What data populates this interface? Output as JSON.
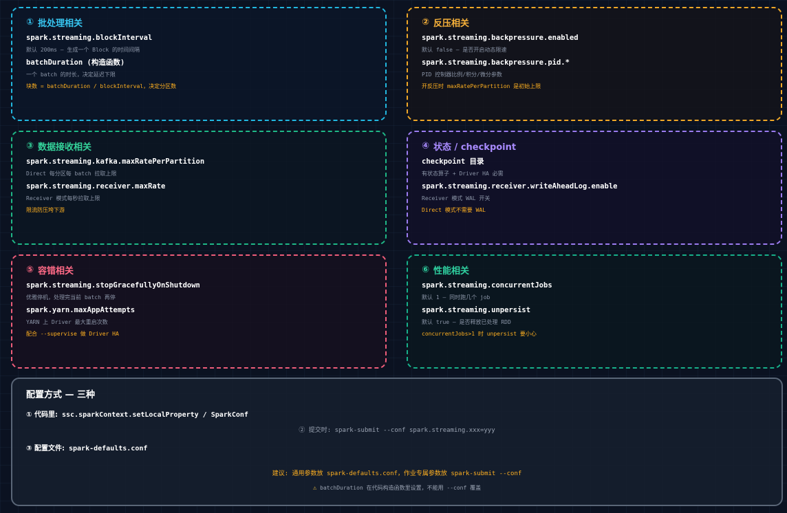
{
  "cards": [
    {
      "num": "①",
      "title": "批处理相关",
      "items": [
        {
          "key": "spark.streaming.blockInterval",
          "desc": "默认 200ms — 生成一个 Block 的时间间隔"
        },
        {
          "key": "batchDuration (构造函数)",
          "desc": "一个 batch 的时长，决定延迟下限"
        }
      ],
      "note": "块数 = batchDuration / blockInterval，决定分区数"
    },
    {
      "num": "②",
      "title": "反压相关",
      "items": [
        {
          "key": "spark.streaming.backpressure.enabled",
          "desc": "默认 false — 是否开启动态限速"
        },
        {
          "key": "spark.streaming.backpressure.pid.*",
          "desc": "PID 控制器比例/积分/微分参数"
        }
      ],
      "note": "开反压时 maxRatePerPartition 是初始上限"
    },
    {
      "num": "③",
      "title": "数据接收相关",
      "items": [
        {
          "key": "spark.streaming.kafka.maxRatePerPartition",
          "desc": "Direct 每分区每 batch 拉取上限"
        },
        {
          "key": "spark.streaming.receiver.maxRate",
          "desc": "Receiver 模式每秒拉取上限"
        }
      ],
      "note": "限流防压垮下游"
    },
    {
      "num": "④",
      "title": "状态 / checkpoint",
      "items": [
        {
          "key": "checkpoint 目录",
          "desc": "有状态算子 + Driver HA 必需"
        },
        {
          "key": "spark.streaming.receiver.writeAheadLog.enable",
          "desc": "Receiver 模式 WAL 开关"
        }
      ],
      "note": "Direct 模式不需要 WAL"
    },
    {
      "num": "⑤",
      "title": "容错相关",
      "items": [
        {
          "key": "spark.streaming.stopGracefullyOnShutdown",
          "desc": "优雅停机，处理完当前 batch 再停"
        },
        {
          "key": "spark.yarn.maxAppAttempts",
          "desc": "YARN 上 Driver 最大重启次数"
        }
      ],
      "note": "配合 --supervise 做 Driver HA"
    },
    {
      "num": "⑥",
      "title": "性能相关",
      "items": [
        {
          "key": "spark.streaming.concurrentJobs",
          "desc": "默认 1 — 同时跑几个 job"
        },
        {
          "key": "spark.streaming.unpersist",
          "desc": "默认 true — 是否释放已处理 RDD"
        }
      ],
      "note": "concurrentJobs>1 时 unpersist 要小心"
    }
  ],
  "summary": {
    "title": "配置方式 — 三种",
    "method1_label": "① 代码里:",
    "method1_value": "ssc.sparkContext.setLocalProperty / SparkConf",
    "method2": "② 提交时: spark-submit --conf spark.streaming.xxx=yyy",
    "method3_label": "③ 配置文件:",
    "method3_value": "spark-defaults.conf",
    "advice": "建议: 通用参数放 spark-defaults.conf，作业专属参数放 spark-submit --conf",
    "warn_icon": "⚠",
    "warning": "batchDuration 在代码构造函数里设置，不能用 --conf 覆盖"
  }
}
